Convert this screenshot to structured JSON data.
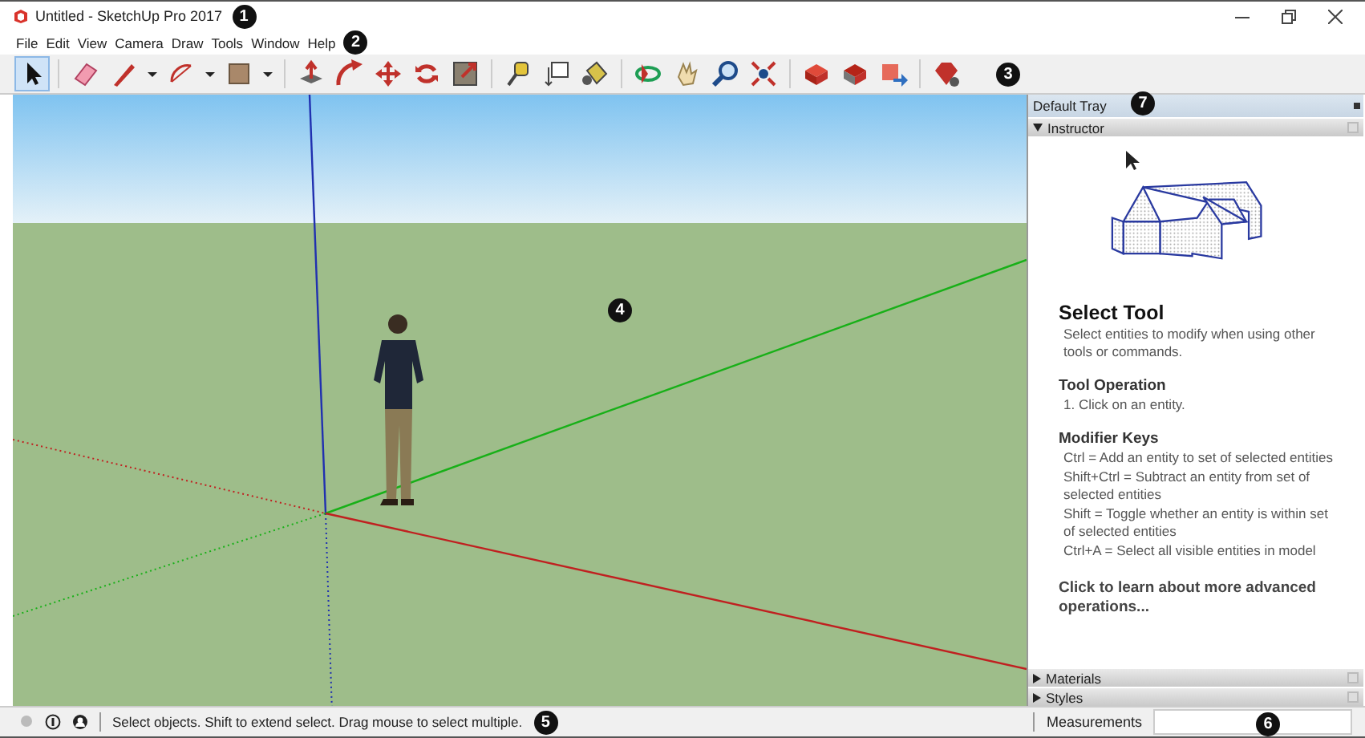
{
  "window": {
    "title": "Untitled - SketchUp Pro 2017"
  },
  "menu": [
    "File",
    "Edit",
    "View",
    "Camera",
    "Draw",
    "Tools",
    "Window",
    "Help"
  ],
  "tools": [
    {
      "selected": true
    },
    {
      "selected": false
    },
    {
      "selected": false
    },
    {
      "selected": false
    },
    {
      "selected": false
    },
    {
      "selected": false
    },
    {
      "selected": false
    },
    {
      "selected": false
    },
    {
      "selected": false
    },
    {
      "selected": false
    },
    {
      "selected": false
    },
    {
      "selected": false
    },
    {
      "selected": false
    },
    {
      "selected": false
    },
    {
      "selected": false
    },
    {
      "selected": false
    },
    {
      "selected": false
    },
    {
      "selected": false
    },
    {
      "selected": false
    },
    {
      "selected": false
    },
    {
      "selected": false
    }
  ],
  "tray": {
    "title": "Default Tray",
    "panels": [
      {
        "name": "Instructor",
        "expanded": true
      },
      {
        "name": "Materials",
        "expanded": false
      },
      {
        "name": "Styles",
        "expanded": false
      }
    ],
    "instructor": {
      "title": "Select Tool",
      "description": "Select entities to modify when using other tools or commands.",
      "sections": [
        {
          "heading": "Tool Operation",
          "lines": [
            "1. Click on an entity."
          ]
        },
        {
          "heading": "Modifier Keys",
          "lines": [
            "Ctrl = Add an entity to set of selected entities",
            "Shift+Ctrl = Subtract an entity from set of selected entities",
            "Shift = Toggle whether an entity is within set of selected entities",
            "Ctrl+A = Select all visible entities in model"
          ]
        }
      ],
      "link": "Click to learn about more advanced operations..."
    }
  },
  "status_bar": {
    "message": "Select objects. Shift to extend select. Drag mouse to select multiple.",
    "measurements_label": "Measurements"
  },
  "callouts": [
    "1",
    "2",
    "3",
    "4",
    "5",
    "6",
    "7"
  ]
}
